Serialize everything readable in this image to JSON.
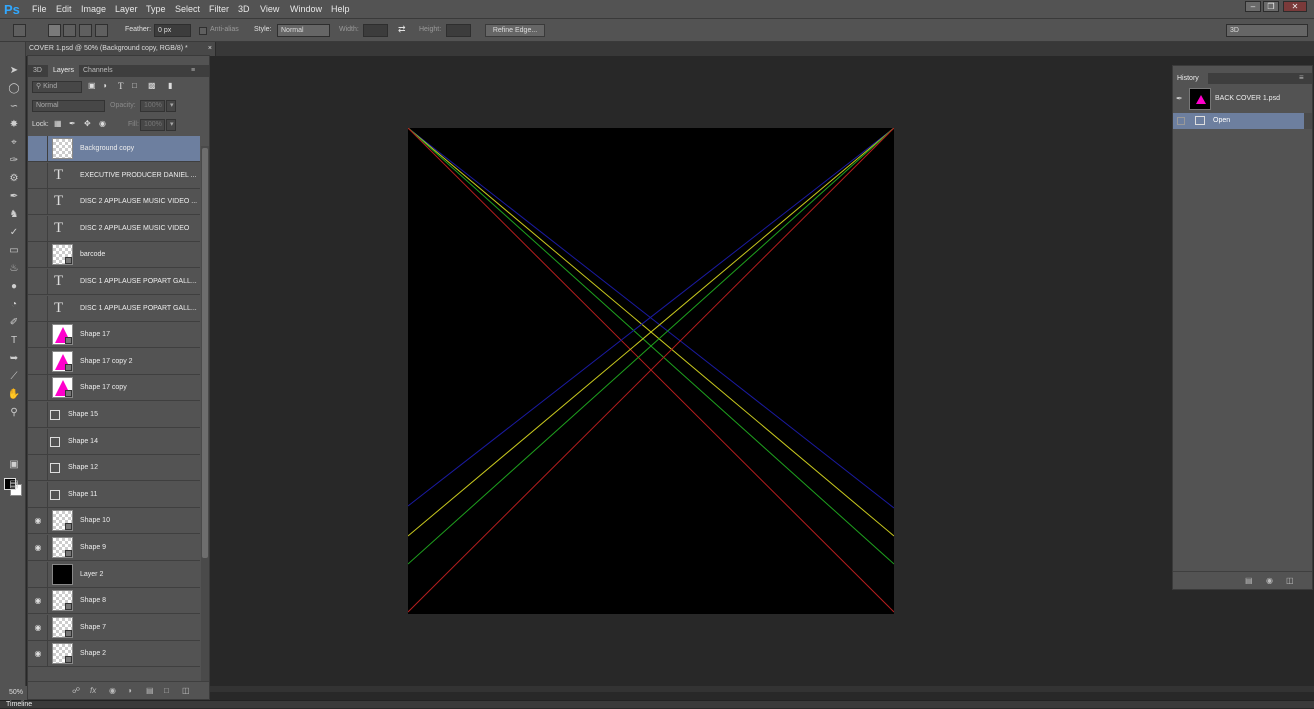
{
  "app": {
    "logo": "Ps"
  },
  "menu": [
    "File",
    "Edit",
    "Image",
    "Layer",
    "Type",
    "Select",
    "Filter",
    "3D",
    "View",
    "Window",
    "Help"
  ],
  "options": {
    "feather_label": "Feather:",
    "feather_value": "0 px",
    "antialias_label": "Anti-alias",
    "style_label": "Style:",
    "style_value": "Normal",
    "width_label": "Width:",
    "height_label": "Height:",
    "refine_edge": "Refine Edge...",
    "workspace": "3D"
  },
  "document": {
    "tab_title": "COVER 1.psd @ 50% (Background copy, RGB/8) *",
    "zoom": "50%"
  },
  "layers_panel": {
    "tabs": [
      "3D",
      "Layers",
      "Channels"
    ],
    "active_tab": "Layers",
    "filter_kind": "Kind",
    "blend_mode": "Normal",
    "opacity_label": "Opacity:",
    "opacity_value": "100%",
    "lock_label": "Lock:",
    "fill_label": "Fill:",
    "fill_value": "100%",
    "layers": [
      {
        "name": "Background copy",
        "type": "pixel",
        "visible": false,
        "selected": true
      },
      {
        "name": "EXECUTIVE PRODUCER DANIEL ...",
        "type": "text",
        "visible": false
      },
      {
        "name": "DISC 2 APPLAUSE MUSIC VIDEO ...",
        "type": "text",
        "visible": false
      },
      {
        "name": "DISC 2 APPLAUSE MUSIC VIDEO",
        "type": "text",
        "visible": false
      },
      {
        "name": "barcode",
        "type": "smart",
        "visible": false
      },
      {
        "name": "DISC 1 APPLAUSE POPART GALL...",
        "type": "text",
        "visible": false
      },
      {
        "name": "DISC 1 APPLAUSE POPART GALL...",
        "type": "text",
        "visible": false
      },
      {
        "name": "Shape 17",
        "type": "shape-pink",
        "visible": false
      },
      {
        "name": "Shape 17 copy 2",
        "type": "shape-pink",
        "visible": false
      },
      {
        "name": "Shape 17 copy",
        "type": "shape-pink",
        "visible": false
      },
      {
        "name": "Shape 15",
        "type": "shape-icon",
        "visible": false
      },
      {
        "name": "Shape 14",
        "type": "shape-icon",
        "visible": false
      },
      {
        "name": "Shape 12",
        "type": "shape-icon",
        "visible": false
      },
      {
        "name": "Shape 11",
        "type": "shape-icon",
        "visible": false
      },
      {
        "name": "Shape 10",
        "type": "smart",
        "visible": true
      },
      {
        "name": "Shape 9",
        "type": "smart",
        "visible": true
      },
      {
        "name": "Layer 2",
        "type": "dark",
        "visible": false
      },
      {
        "name": "Shape 8",
        "type": "smart",
        "visible": true
      },
      {
        "name": "Shape 7",
        "type": "smart",
        "visible": true
      },
      {
        "name": "Shape 2",
        "type": "smart",
        "visible": true
      }
    ]
  },
  "history_panel": {
    "title": "History",
    "snapshot": "BACK COVER 1.psd",
    "states": [
      "Open"
    ]
  },
  "timeline": {
    "label": "Timeline"
  },
  "colors": {
    "accent_selected": "#6d7f9f",
    "panel": "#535353",
    "shape_pink": "#ff00cc"
  }
}
